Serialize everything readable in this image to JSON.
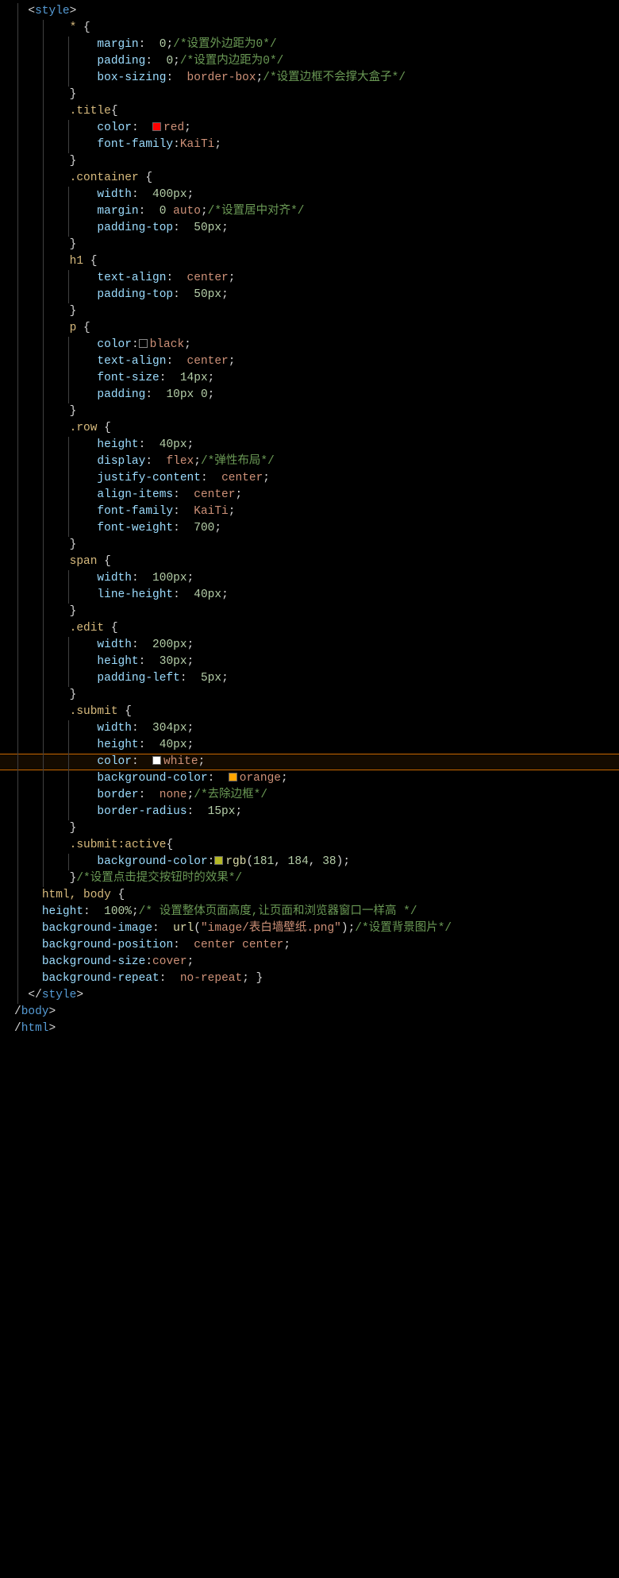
{
  "code": {
    "openStyle": "<style>",
    "closeStyle": "</style>",
    "closeBody": "/body>",
    "closeHtml": "/html>",
    "rules": [
      {
        "sel": "*",
        "open": "* {",
        "props": [
          {
            "p": "margin",
            "v": "0",
            "c": "/*设置外边距为0*/"
          },
          {
            "p": "padding",
            "v": "0",
            "c": "/*设置内边距为0*/"
          },
          {
            "p": "box-sizing",
            "v": "border-box",
            "c": "/*设置边框不会撑大盒子*/"
          }
        ]
      },
      {
        "sel": ".title",
        "open": ".title{",
        "props": [
          {
            "p": "color",
            "v": "red",
            "sw": "#ff0000"
          },
          {
            "p": "font-family",
            "v": "KaiTi",
            "nospace": true
          }
        ]
      },
      {
        "sel": ".container",
        "open": ".container {",
        "props": [
          {
            "p": "width",
            "v": "400px"
          },
          {
            "p": "margin",
            "v": "0 auto",
            "c": "/*设置居中对齐*/"
          },
          {
            "p": "padding-top",
            "v": "50px"
          }
        ],
        "gap": true
      },
      {
        "sel": "h1",
        "open": "h1 {",
        "props": [
          {
            "p": "text-align",
            "v": "center"
          },
          {
            "p": "padding-top",
            "v": "50px"
          }
        ],
        "gap": true
      },
      {
        "sel": "p",
        "open": "p {",
        "props": [
          {
            "p": "color",
            "v": "black",
            "sw": "#000000",
            "nospace": true
          },
          {
            "p": "text-align",
            "v": "center"
          },
          {
            "p": "font-size",
            "v": "14px"
          },
          {
            "p": "padding",
            "v": "10px 0"
          }
        ],
        "gap": true
      },
      {
        "sel": ".row",
        "open": ".row {",
        "props": [
          {
            "p": "height",
            "v": "40px"
          },
          {
            "p": "display",
            "v": "flex",
            "c": "/*弹性布局*/"
          },
          {
            "p": "justify-content",
            "v": "center"
          },
          {
            "p": "align-items",
            "v": "center"
          },
          {
            "p": "font-family",
            "v": "KaiTi"
          },
          {
            "p": "font-weight",
            "v": "700"
          }
        ],
        "gap": true
      },
      {
        "sel": "span",
        "open": "span {",
        "props": [
          {
            "p": "width",
            "v": "100px"
          },
          {
            "p": "line-height",
            "v": "40px"
          }
        ],
        "gap": true
      },
      {
        "sel": ".edit",
        "open": ".edit {",
        "props": [
          {
            "p": "width",
            "v": "200px"
          },
          {
            "p": "height",
            "v": "30px"
          },
          {
            "p": "padding-left",
            "v": "5px"
          }
        ],
        "gap": true
      },
      {
        "sel": ".submit",
        "open": ".submit {",
        "props": [
          {
            "p": "width",
            "v": "304px"
          },
          {
            "p": "height",
            "v": "40px"
          },
          {
            "p": "color",
            "v": "white",
            "sw": "#ffffff",
            "hl": true
          },
          {
            "p": "background-color",
            "v": "orange",
            "sw": "#ffa500"
          },
          {
            "p": "border",
            "v": "none",
            "c": "/*去除边框*/"
          },
          {
            "p": "border-radius",
            "v": "15px"
          }
        ],
        "gap": true
      },
      {
        "sel": ".submit:active",
        "open": ".submit:active{",
        "props": [
          {
            "p": "background-color",
            "v": "rgb(181, 184, 38)",
            "sw": "#b5b826",
            "fn": true,
            "nospace": true
          }
        ],
        "closec": "/*设置点击提交按钮时的效果*/"
      },
      {
        "sel": "html, body",
        "open": "html, body {",
        "level": 1,
        "props": [
          {
            "p": "height",
            "v": "100%",
            "c": "/* 设置整体页面高度,让页面和浏览器窗口一样高 */",
            "level": 1
          },
          {
            "p": "background-image",
            "v": "url(\"image/表白墙壁纸.png\")",
            "c": "/*设置背景图片*/",
            "fn": true,
            "level": 1
          },
          {
            "p": "background-position",
            "v": "center center",
            "level": 1
          },
          {
            "p": "background-size",
            "v": "cover",
            "nospace": true,
            "level": 1
          },
          {
            "p": "background-repeat",
            "v": "no-repeat",
            "level": 1,
            "inlineClose": true
          }
        ]
      }
    ]
  }
}
